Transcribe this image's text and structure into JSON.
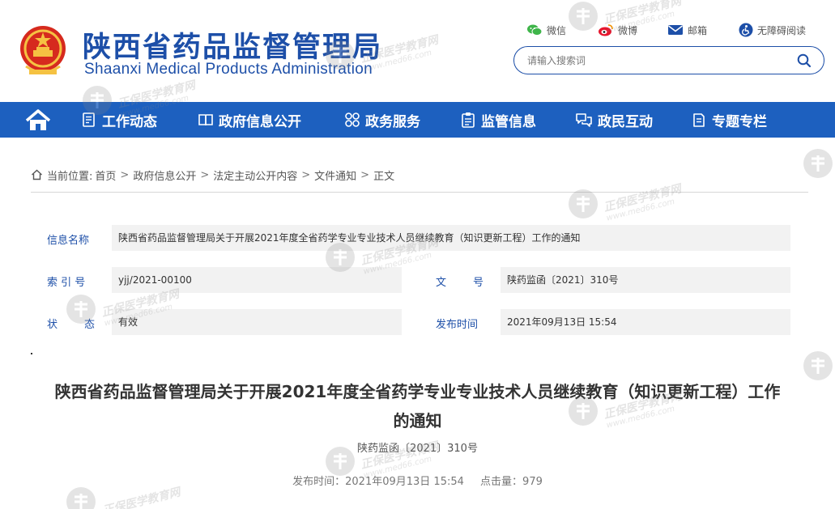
{
  "header": {
    "title": "陕西省药品监督管理局",
    "subtitle": "Shaanxi Medical Products Administration",
    "links": [
      {
        "label": "微信",
        "icon": "wechat-icon"
      },
      {
        "label": "微博",
        "icon": "weibo-icon"
      },
      {
        "label": "邮箱",
        "icon": "mail-icon"
      },
      {
        "label": "无障碍阅读",
        "icon": "accessibility-icon"
      }
    ],
    "search": {
      "placeholder": "请输入搜索词",
      "icon": "search-icon"
    }
  },
  "nav": {
    "home_icon": "home-icon",
    "items": [
      {
        "label": "工作动态",
        "icon": "document-icon"
      },
      {
        "label": "政府信息公开",
        "icon": "book-icon"
      },
      {
        "label": "政务服务",
        "icon": "grid-icon"
      },
      {
        "label": "监管信息",
        "icon": "clipboard-icon"
      },
      {
        "label": "政民互动",
        "icon": "chat-icon"
      },
      {
        "label": "专题专栏",
        "icon": "note-icon"
      }
    ]
  },
  "breadcrumb": {
    "prefix": "当前位置:",
    "items": [
      "首页",
      "政府信息公开",
      "法定主动公开内容",
      "文件通知",
      "正文"
    ],
    "separator": ">"
  },
  "info": {
    "name_label": "信息名称",
    "name_value": "陕西省药品监督管理局关于开展2021年度全省药学专业专业技术人员继续教育（知识更新工程）工作的通知",
    "index_label": "索 引 号",
    "index_value": "yjj/2021-00100",
    "docno_label": "文        号",
    "docno_value": "陕药监函〔2021〕310号",
    "status_label": "状        态",
    "status_value": "有效",
    "date_label": "发布时间",
    "date_value": "2021年09月13日 15:54"
  },
  "article": {
    "title": "陕西省药品监督管理局关于开展2021年度全省药学专业专业技术人员继续教育（知识更新工程）工作的通知",
    "doc_number": "陕药监函〔2021〕310号",
    "publish_label": "发布时间：",
    "publish_time": "2021年09月13日 15:54",
    "views_label": "点击量：",
    "views": "979"
  },
  "watermark": {
    "cn": "正保医学教育网",
    "en": "www.med66.com"
  },
  "colors": {
    "brand_blue": "#1d4fa8",
    "nav_blue": "#1d60bf",
    "info_bg": "#f2f2f2"
  }
}
